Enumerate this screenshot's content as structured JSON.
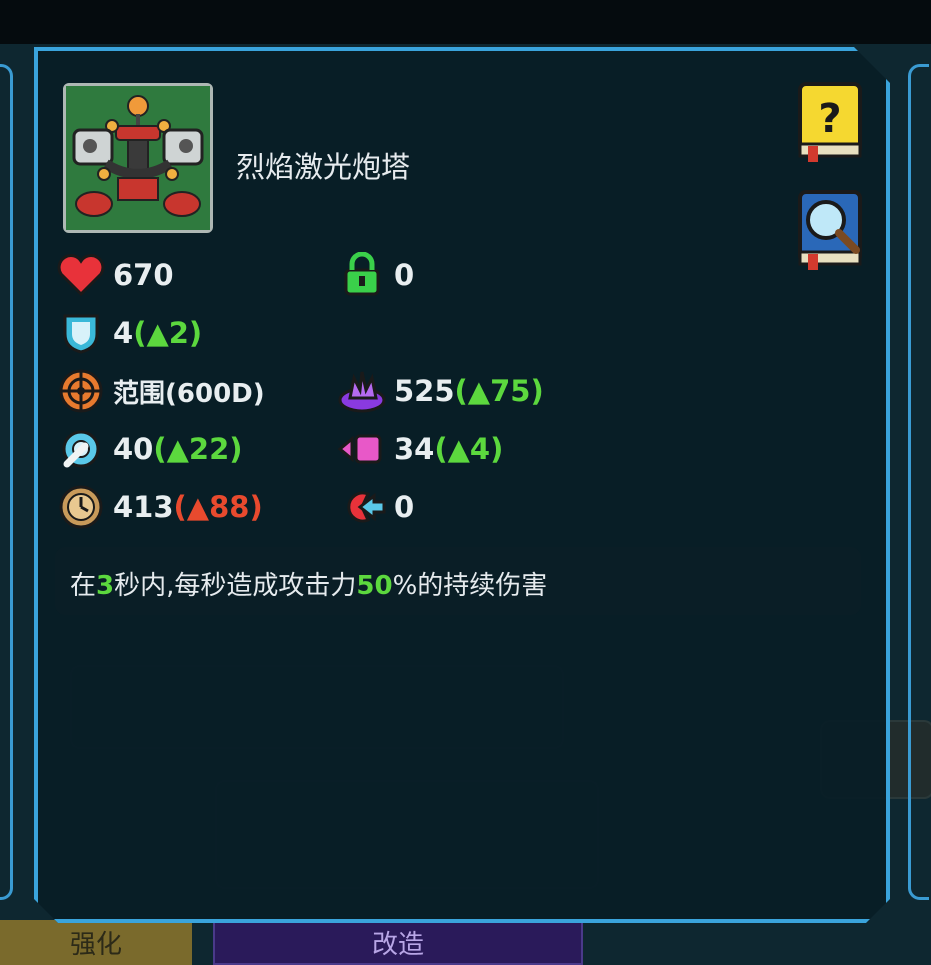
{
  "tower": {
    "name": "烈焰激光炮塔"
  },
  "stats": {
    "health": {
      "value": "670"
    },
    "shield_gate": {
      "value": "0"
    },
    "armor": {
      "value": "4",
      "delta": "(▲2)"
    },
    "range": {
      "value": "范围(600D)"
    },
    "attack": {
      "value": "525",
      "delta": "(▲75)"
    },
    "attack_speed": {
      "value": "40",
      "delta": "(▲22)"
    },
    "knockback": {
      "value": "34",
      "delta": "(▲4)"
    },
    "cooldown": {
      "value": "413",
      "delta": "(▲88)"
    },
    "retreat": {
      "value": "0"
    }
  },
  "description": {
    "p1": "在",
    "n1": "3",
    "p2": "秒内,每秒造成攻击力",
    "n2": "50",
    "p3": "%的持续伤害"
  },
  "bottom_tabs": {
    "left": "强化",
    "middle": "改造"
  },
  "icons": [
    "heart-icon",
    "lock-icon",
    "shield-icon",
    "crosshair-icon",
    "purple-flame-icon",
    "gear-wrench-icon",
    "knockback-icon",
    "clock-gear-icon",
    "retreat-icon",
    "help-book-icon",
    "magnify-book-icon"
  ],
  "colors": {
    "accent": "#3aa4dc",
    "increase": "#5cd83e",
    "decrease": "#e84a2e"
  }
}
